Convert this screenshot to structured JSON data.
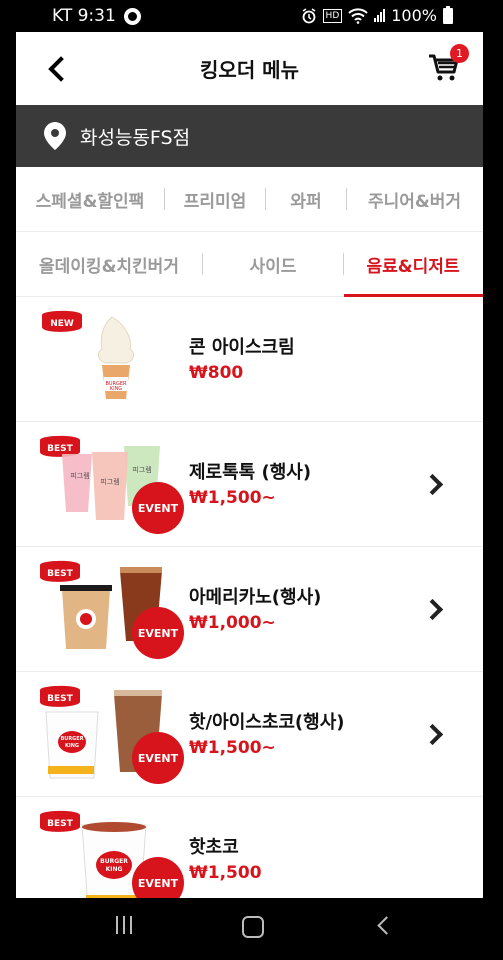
{
  "status": {
    "carrier_time": "KT 9:31",
    "battery_pct": "100%",
    "hd_label": "HD"
  },
  "header": {
    "title": "킹오더 메뉴",
    "cart_count": "1"
  },
  "store": {
    "name": "화성능동FS점"
  },
  "tabs_row1": [
    "스페셜&할인팩",
    "프리미엄",
    "와퍼",
    "주니어&버거"
  ],
  "tabs_row2": [
    "올데이킹&치킨버거",
    "사이드",
    "음료&디저트"
  ],
  "active_tab": "음료&디저트",
  "items": [
    {
      "name": "콘 아이스크림",
      "price": "₩800",
      "badge": "NEW",
      "event": false,
      "has_options": false
    },
    {
      "name": "제로톡톡 (행사)",
      "price": "₩1,500~",
      "badge": "BEST",
      "event": true,
      "has_options": true
    },
    {
      "name": "아메리카노(행사)",
      "price": "₩1,000~",
      "badge": "BEST",
      "event": true,
      "has_options": true
    },
    {
      "name": "핫/아이스초코(행사)",
      "price": "₩1,500~",
      "badge": "BEST",
      "event": true,
      "has_options": true
    },
    {
      "name": "핫초코",
      "price": "₩1,500",
      "badge": "BEST",
      "event": true,
      "has_options": false
    }
  ],
  "labels": {
    "event": "EVENT",
    "cup_text": "피그렘",
    "brand_line1": "BURGER",
    "brand_line2": "KING"
  },
  "colors": {
    "accent_red": "#d7141c",
    "store_bar": "#3a3a3a"
  },
  "icons": {
    "back": "chevron-left-icon",
    "cart": "cart-icon",
    "pin": "location-pin-icon",
    "chevron": "chevron-right-icon"
  }
}
